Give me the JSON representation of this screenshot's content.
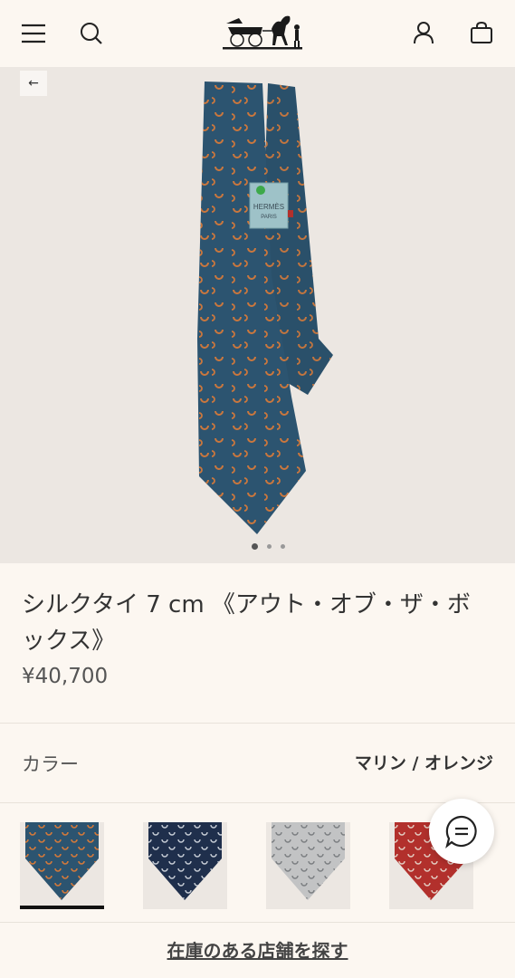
{
  "header": {
    "icons": [
      "menu-icon",
      "search-icon",
      "hermes-carriage-logo",
      "account-icon",
      "shopping-bag-icon"
    ]
  },
  "hero": {
    "back_label": "←",
    "carousel_count": 3,
    "carousel_active_index": 0,
    "tie_colors": {
      "background": "#2c5470",
      "pattern": "#d3793a",
      "label": "#9ec2c8"
    },
    "tie_label": {
      "brand": "HERMÈS",
      "city": "PARIS"
    }
  },
  "product": {
    "title": "シルクタイ 7 cm 《アウト・オブ・ザ・ボックス》",
    "price": "¥40,700"
  },
  "color": {
    "label": "カラー",
    "selected": "マリン / オレンジ",
    "swatches": [
      {
        "name": "marine-orange",
        "color": "#2c5470",
        "pattern": "#d3793a",
        "selected": true
      },
      {
        "name": "navy-grey",
        "color": "#1f2f4c",
        "pattern": "#c9cfd8",
        "selected": false
      },
      {
        "name": "grey",
        "color": "#c2c3c4",
        "pattern": "#7a7d80",
        "selected": false
      },
      {
        "name": "red",
        "color": "#b2302c",
        "pattern": "#e4cfc4",
        "selected": false
      }
    ]
  },
  "store_link": "在庫のある店舗を探す"
}
